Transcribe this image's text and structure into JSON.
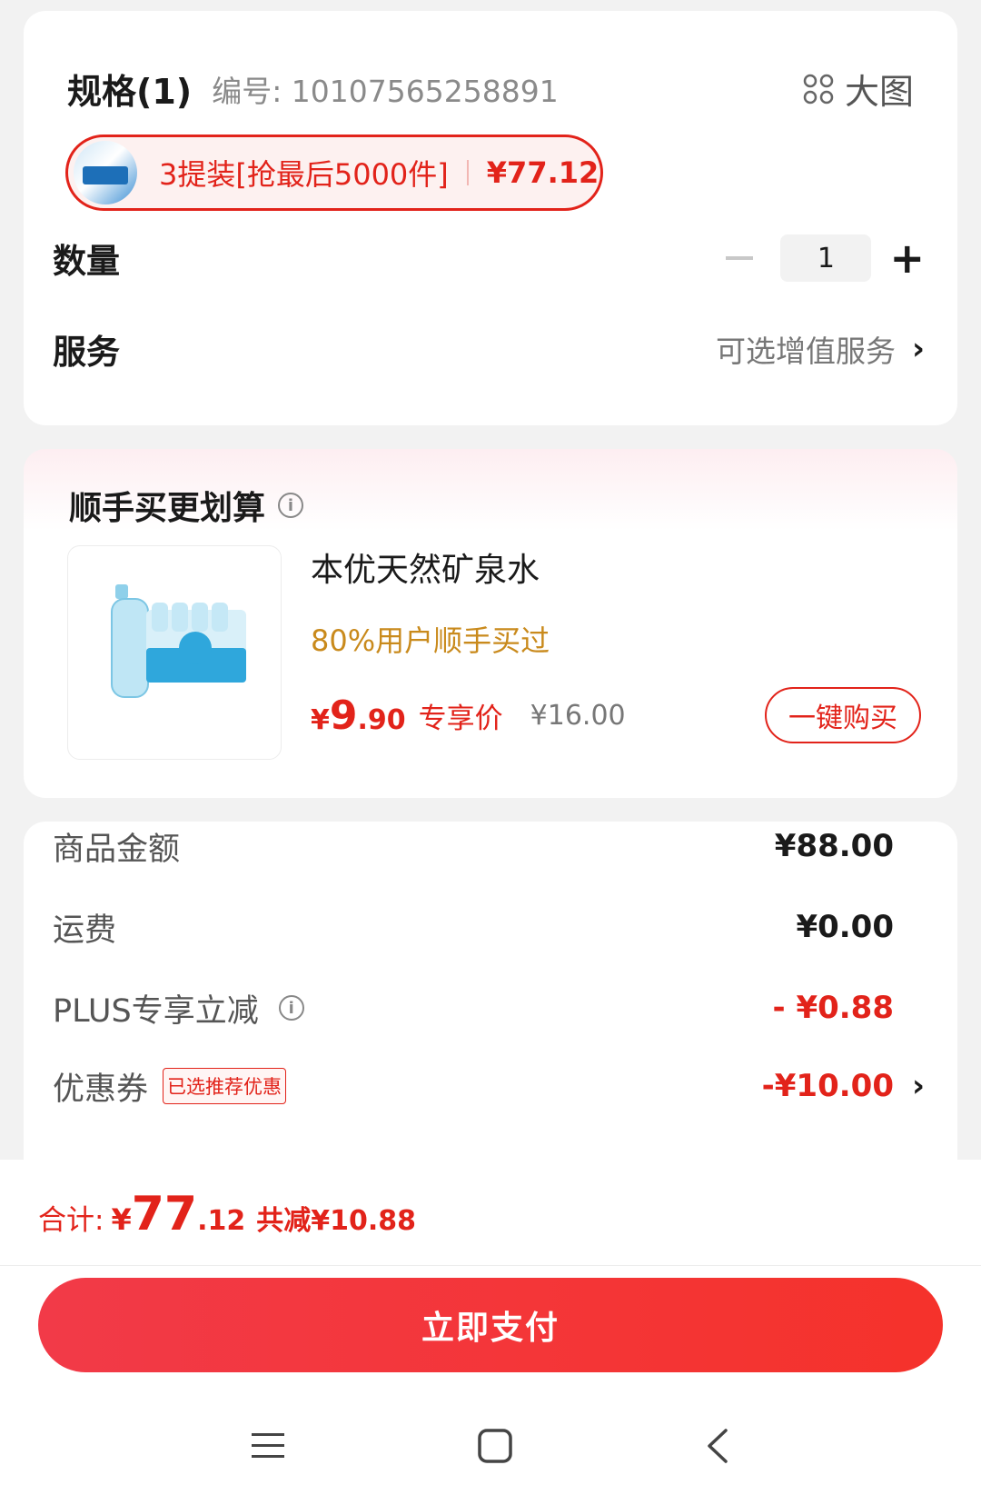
{
  "spec": {
    "title": "规格(1)",
    "sku_label": "编号: 10107565258891",
    "big_image_label": "大图",
    "variant": {
      "name": "3提装[抢最后5000件]",
      "price": "¥77.12"
    }
  },
  "quantity": {
    "label": "数量",
    "value": "1",
    "plus": "+"
  },
  "service": {
    "label": "服务",
    "link_text": "可选增值服务",
    "chevron": "›"
  },
  "recommend": {
    "title": "顺手买更划算",
    "product": {
      "name": "本优天然矿泉水",
      "stat": "80%用户顺手买过",
      "price_yen": "¥",
      "price_int": "9",
      "price_dec": ".90",
      "exclusive_label": "专享价",
      "original_price": "¥16.00",
      "buy_button": "一键购买"
    }
  },
  "summary": {
    "rows": [
      {
        "label": "商品金额",
        "value": "¥88.00"
      },
      {
        "label": "运费",
        "value": "¥0.00"
      },
      {
        "label": "PLUS专享立减",
        "value": "- ¥0.88"
      },
      {
        "label": "优惠券",
        "tag": "已选推荐优惠",
        "value": "-¥10.00",
        "chevron": "›"
      }
    ]
  },
  "total": {
    "label": "合计:",
    "yen": "¥",
    "int": "77",
    "dec": ".12",
    "saved": "共减¥10.88"
  },
  "pay_button": "立即支付",
  "colors": {
    "accent": "#e2231a",
    "stat": "#c98a1c",
    "pay_gradient_start": "#f23a48",
    "pay_gradient_end": "#f5322b"
  },
  "icons": [
    "grid-icon",
    "info-icon",
    "chevron-right-icon",
    "menu-icon",
    "home-icon",
    "back-icon"
  ]
}
